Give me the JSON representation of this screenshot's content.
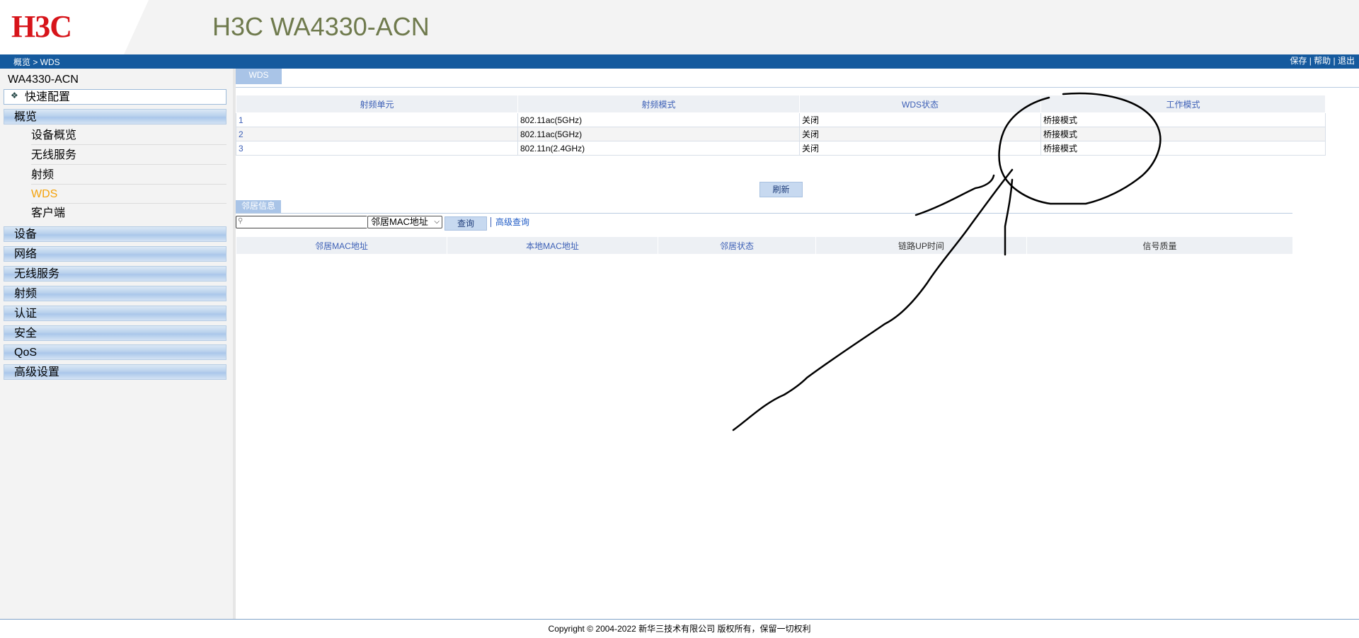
{
  "header": {
    "logo": "H3C",
    "product_title": "H3C WA4330-ACN"
  },
  "navbar": {
    "breadcrumb": "概览 > WDS",
    "save": "保存",
    "help": "帮助",
    "logout": "退出",
    "sep": "|"
  },
  "sidebar": {
    "device_name": "WA4330-ACN",
    "quick_config_bullet": "❖",
    "quick_config": "快速配置",
    "overview": "概览",
    "overview_items": [
      "设备概览",
      "无线服务",
      "射频",
      "WDS",
      "客户端"
    ],
    "active_item": "WDS",
    "sections": [
      "设备",
      "网络",
      "无线服务",
      "射频",
      "认证",
      "安全",
      "QoS",
      "高级设置"
    ]
  },
  "main": {
    "tab": "WDS",
    "radio_table": {
      "headers": [
        "射频单元",
        "射频模式",
        "WDS状态",
        "工作模式"
      ],
      "rows": [
        [
          "1",
          "802.11ac(5GHz)",
          "关闭",
          "桥接模式"
        ],
        [
          "2",
          "802.11ac(5GHz)",
          "关闭",
          "桥接模式"
        ],
        [
          "3",
          "802.11n(2.4GHz)",
          "关闭",
          "桥接模式"
        ]
      ]
    },
    "refresh_button": "刷新",
    "neighbor_section": "邻居信息",
    "search": {
      "value": "",
      "placeholder": ""
    },
    "search_field_select": "邻居MAC地址",
    "query_button": "查询",
    "advanced_query": "高级查询",
    "neighbor_table": {
      "headers": [
        "邻居MAC地址",
        "本地MAC地址",
        "邻居状态",
        "链路UP时间",
        "信号质量"
      ]
    }
  },
  "footer": {
    "copyright": "Copyright © 2004-2022 新华三技术有限公司 版权所有，保留一切权利"
  },
  "colors": {
    "navbar": "#155a9e",
    "logo_red": "#d7141a",
    "title_olive": "#6f7a4d",
    "active_menu": "#f4a20a",
    "table_header_text": "#3c5fb6"
  }
}
